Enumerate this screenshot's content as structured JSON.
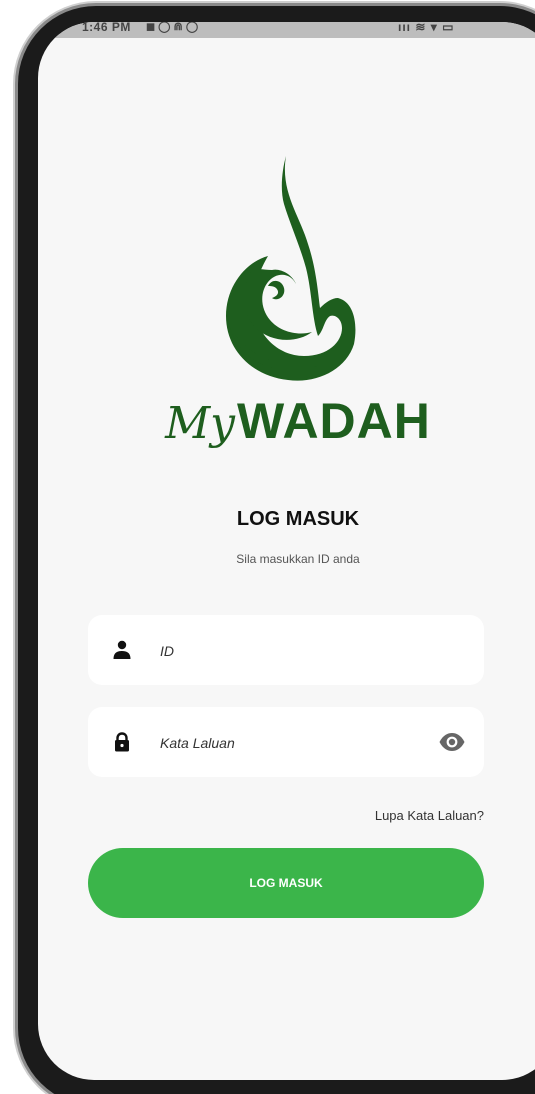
{
  "status_bar": {
    "time": "1:46 PM",
    "left_icons": "◼ ◯ ⋒ ◯",
    "right_icons": "ııı ≋ ▾ ▭"
  },
  "brand": {
    "prefix": "My",
    "name": "WADAH",
    "logo_icon": "wadah-calligraphy-logo-icon",
    "color": "#1e5e1e"
  },
  "login": {
    "title": "LOG MASUK",
    "subtitle": "Sila masukkan ID anda"
  },
  "form": {
    "id_field": {
      "icon": "user-icon",
      "placeholder": "ID",
      "value": ""
    },
    "password_field": {
      "icon": "lock-icon",
      "placeholder": "Kata Laluan",
      "value": "",
      "toggle_icon": "eye-icon"
    },
    "forgot_password": "Lupa Kata Laluan?",
    "submit_label": "LOG MASUK"
  },
  "colors": {
    "accent_green": "#3bb54a",
    "brand_green": "#1e5e1e",
    "screen_background": "#f7f7f7"
  }
}
